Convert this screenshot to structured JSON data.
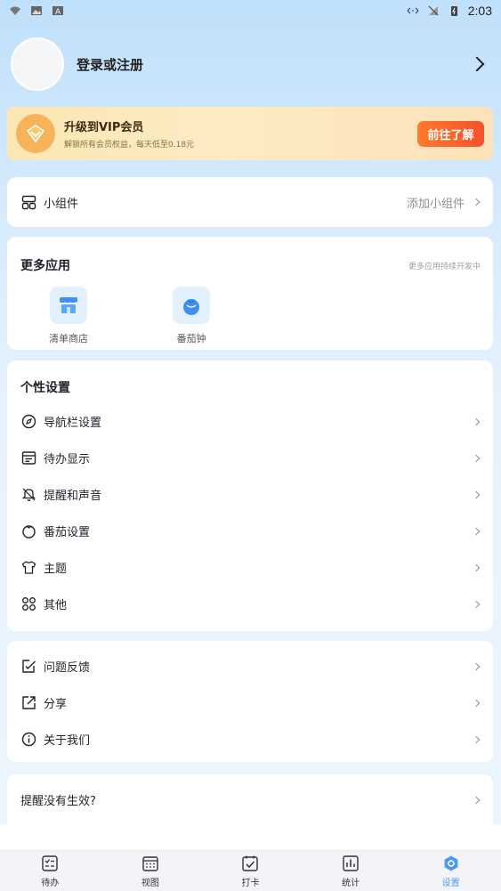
{
  "status_bar": {
    "time": "2:03"
  },
  "profile": {
    "login_text": "登录或注册"
  },
  "vip": {
    "title": "升级到VIP会员",
    "subtitle": "解锁所有会员权益，每天低至0.18元",
    "button": "前往了解"
  },
  "widget": {
    "label": "小组件",
    "action": "添加小组件"
  },
  "more_apps": {
    "title": "更多应用",
    "hint": "更多应用持续开发中",
    "apps": [
      {
        "label": "清单商店",
        "icon": "store-icon"
      },
      {
        "label": "番茄钟",
        "icon": "tomato-icon"
      }
    ]
  },
  "personal": {
    "title": "个性设置",
    "items": [
      {
        "label": "导航栏设置",
        "icon": "compass-icon"
      },
      {
        "label": "待办显示",
        "icon": "todo-display-icon"
      },
      {
        "label": "提醒和声音",
        "icon": "bell-icon"
      },
      {
        "label": "番茄设置",
        "icon": "tomato-outline-icon"
      },
      {
        "label": "主题",
        "icon": "tshirt-icon"
      },
      {
        "label": "其他",
        "icon": "grid-icon"
      }
    ]
  },
  "support": {
    "items": [
      {
        "label": "问题反馈",
        "icon": "feedback-icon"
      },
      {
        "label": "分享",
        "icon": "share-icon"
      },
      {
        "label": "关于我们",
        "icon": "info-icon"
      }
    ]
  },
  "reminder_help": {
    "label": "提醒没有生效?"
  },
  "bottom_nav": {
    "items": [
      {
        "label": "待办",
        "icon": "todo-icon"
      },
      {
        "label": "视图",
        "icon": "calendar-icon"
      },
      {
        "label": "打卡",
        "icon": "checkin-icon"
      },
      {
        "label": "统计",
        "icon": "stats-icon"
      },
      {
        "label": "设置",
        "icon": "settings-icon",
        "active": true
      }
    ]
  },
  "colors": {
    "accent": "#4a9af0",
    "vip_button": "#f5512a",
    "page_bg": "#d4eafc"
  }
}
